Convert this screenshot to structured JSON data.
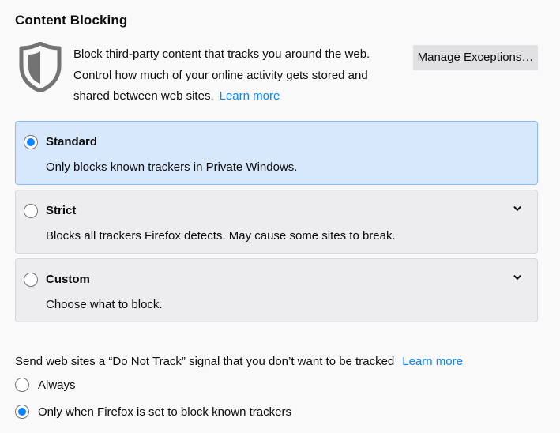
{
  "header": {
    "title": "Content Blocking"
  },
  "intro": {
    "line1": "Block third-party content that tracks you around the web.",
    "line2": "Control how much of your online activity gets stored and",
    "line3": "shared between web sites.",
    "learn_more": "Learn more"
  },
  "manage_button": {
    "label": "Manage Exceptions…"
  },
  "options": {
    "standard": {
      "title": "Standard",
      "description": "Only blocks known trackers in Private Windows.",
      "selected": true
    },
    "strict": {
      "title": "Strict",
      "description": "Blocks all trackers Firefox detects. May cause some sites to break.",
      "selected": false
    },
    "custom": {
      "title": "Custom",
      "description": "Choose what to block.",
      "selected": false
    }
  },
  "dnt": {
    "label": "Send web sites a “Do Not Track” signal that you don’t want to be tracked",
    "learn_more": "Learn more",
    "always": "Always",
    "only_when": "Only when Firefox is set to block known trackers",
    "selected": "only_when"
  },
  "colors": {
    "accent": "#0a84ff",
    "selected_card_bg": "#d7e8fc",
    "selected_card_border": "#8ab9f8",
    "card_bg": "#ededf0",
    "button_bg": "#e1e1e3",
    "shield": "#737373"
  },
  "icons": {
    "shield": "shield-icon",
    "chevron": "chevron-down-icon"
  }
}
